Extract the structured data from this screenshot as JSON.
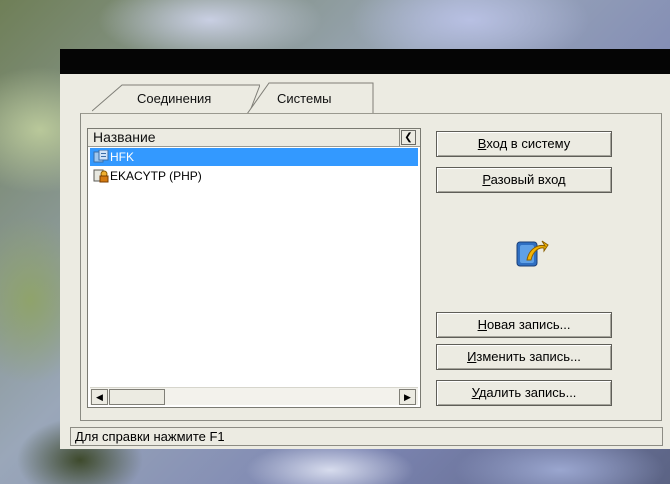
{
  "tabs": [
    {
      "label": "Соединения"
    },
    {
      "label": "Системы"
    }
  ],
  "list": {
    "column_header": "Название",
    "rows": [
      {
        "label": "HFK",
        "icon": "system-icon",
        "selected": true
      },
      {
        "label": "EKACYTP (PHP)",
        "icon": "locked-system-icon",
        "selected": false
      }
    ]
  },
  "buttons": {
    "login": {
      "first": "В",
      "rest": "ход в систему"
    },
    "single_login": {
      "first": "Р",
      "rest": "азовый вход"
    },
    "new_entry": {
      "first": "Н",
      "rest": "овая запись..."
    },
    "edit_entry": {
      "first": "И",
      "rest": "зменить запись..."
    },
    "delete_entry": {
      "first": "У",
      "rest": "далить запись..."
    }
  },
  "status": {
    "text": "Для справки нажмите F1"
  },
  "colors": {
    "selection": "#3399ff",
    "dialog_bg": "#ecebe2",
    "titlebar": "#050505"
  }
}
